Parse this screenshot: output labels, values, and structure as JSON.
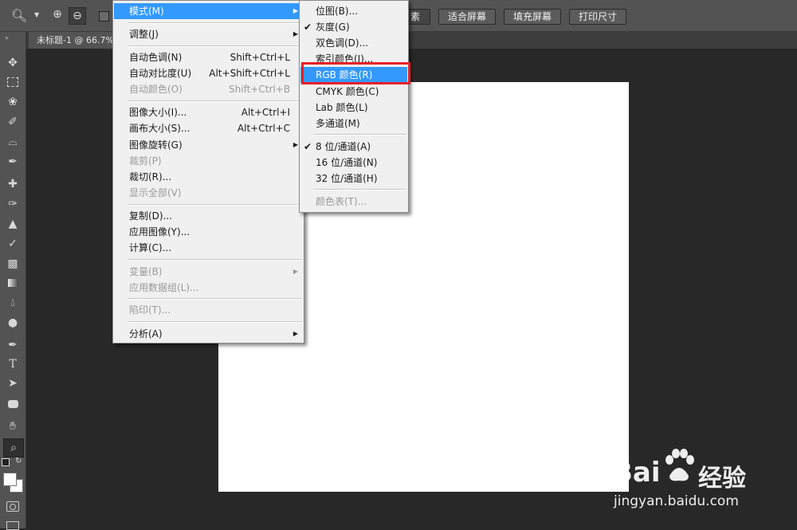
{
  "optionsbar": {
    "buttons": [
      "素",
      "适合屏幕",
      "填充屏幕",
      "打印尺寸"
    ]
  },
  "document": {
    "tab_title": "未标题-1 @ 66.7%"
  },
  "image_menu": {
    "mode": "模式(M)",
    "adjust": "调整(J)",
    "auto_tone": "自动色调(N)",
    "auto_tone_sc": "Shift+Ctrl+L",
    "auto_contrast": "自动对比度(U)",
    "auto_contrast_sc": "Alt+Shift+Ctrl+L",
    "auto_color": "自动颜色(O)",
    "auto_color_sc": "Shift+Ctrl+B",
    "image_size": "图像大小(I)...",
    "image_size_sc": "Alt+Ctrl+I",
    "canvas_size": "画布大小(S)...",
    "canvas_size_sc": "Alt+Ctrl+C",
    "rotation": "图像旋转(G)",
    "crop": "裁剪(P)",
    "trim": "裁切(R)...",
    "reveal_all": "显示全部(V)",
    "duplicate": "复制(D)...",
    "apply_image": "应用图像(Y)...",
    "calculations": "计算(C)...",
    "variables": "变量(B)",
    "apply_dataset": "应用数据组(L)...",
    "trap": "陷印(T)...",
    "analysis": "分析(A)"
  },
  "mode_menu": {
    "bitmap": "位图(B)...",
    "grayscale": "灰度(G)",
    "duotone": "双色调(D)...",
    "indexed": "索引颜色(I)...",
    "rgb": "RGB 颜色(R)",
    "cmyk": "CMYK 颜色(C)",
    "lab": "Lab 颜色(L)",
    "multichannel": "多通道(M)",
    "bit8": "8 位/通道(A)",
    "bit16": "16 位/通道(N)",
    "bit32": "32 位/通道(H)",
    "color_table": "颜色表(T)..."
  },
  "watermark": {
    "brand": "Bai",
    "brand2": "经验",
    "url": "jingyan.baidu.com"
  },
  "colors": {
    "highlight": "#3399ff",
    "annotation": "#e8202a"
  }
}
